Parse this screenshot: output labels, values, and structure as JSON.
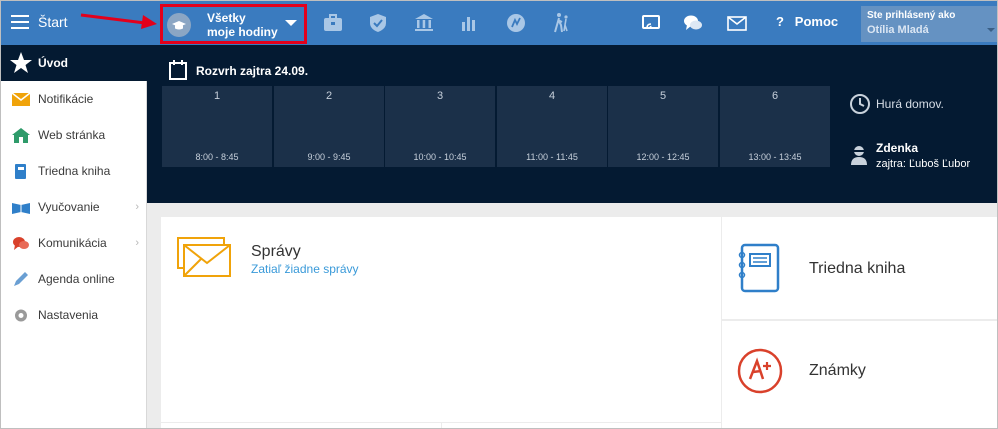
{
  "topbar": {
    "start_label": "Štart",
    "class_selector": {
      "line1": "Všetky",
      "line2": "moje hodiny"
    },
    "icons": [
      "briefcase-icon",
      "shield-icon",
      "bank-icon",
      "bar-chart-icon",
      "compass-icon",
      "walking-icon",
      "cast-icon",
      "chat-icon",
      "mail-icon"
    ],
    "help_label": "Pomoc",
    "user_label": "Ste prihlásený ako",
    "user_name": "Otília Mladá"
  },
  "sidebar": {
    "items": [
      {
        "label": "Úvod",
        "icon": "star-icon",
        "active": true
      },
      {
        "label": "Notifikácie",
        "icon": "envelope-icon"
      },
      {
        "label": "Web stránka",
        "icon": "house-icon"
      },
      {
        "label": "Triedna kniha",
        "icon": "book-icon"
      },
      {
        "label": "Vyučovanie",
        "icon": "open-book-icon",
        "submenu": true
      },
      {
        "label": "Komunikácia",
        "icon": "speech-icon",
        "submenu": true
      },
      {
        "label": "Agenda online",
        "icon": "pen-icon"
      },
      {
        "label": "Nastavenia",
        "icon": "gear-icon"
      }
    ]
  },
  "schedule": {
    "title": "Rozvrh zajtra 24.09.",
    "slots": [
      {
        "num": "1",
        "time": "8:00 - 8:45"
      },
      {
        "num": "2",
        "time": "9:00 - 9:45"
      },
      {
        "num": "3",
        "time": "10:00 - 10:45"
      },
      {
        "num": "4",
        "time": "11:00 - 11:45"
      },
      {
        "num": "5",
        "time": "12:00 - 12:45"
      },
      {
        "num": "6",
        "time": "13:00 - 13:45"
      }
    ],
    "home_text": "Hurá domov.",
    "teacher_name": "Zdenka",
    "teacher_sub": "zajtra: Ľuboš Ľubor"
  },
  "cards": {
    "messages_title": "Správy",
    "messages_sub": "Zatiaľ žiadne správy",
    "classbook": "Triedna kniha",
    "grades": "Známky"
  },
  "colors": {
    "topbar": "#3a7bbf",
    "dark": "#041a32",
    "slot": "#1b3049",
    "highlight": "#e3001b",
    "link": "#3a9ad9",
    "orange": "#f0a30a"
  }
}
